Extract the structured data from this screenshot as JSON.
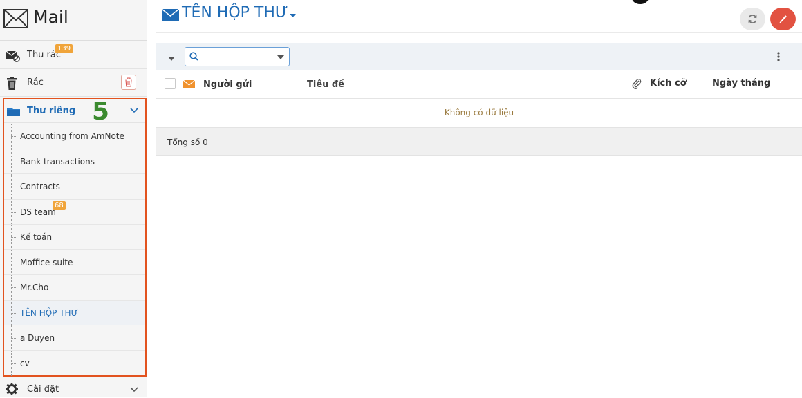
{
  "app": {
    "title": "Mail",
    "icon": "mail-envelope-icon"
  },
  "sidebar": {
    "spam": {
      "label": "Thư rác",
      "badge": "139",
      "icon": "spam-mail-icon"
    },
    "trash": {
      "label": "Rác",
      "icon": "trash-icon"
    },
    "folder": {
      "label": "Thư riêng",
      "step_number": "5",
      "icon": "folder-icon",
      "items": [
        {
          "label": "Accounting from AmNote"
        },
        {
          "label": "Bank transactions"
        },
        {
          "label": "Contracts"
        },
        {
          "label": "DS team",
          "badge": "68"
        },
        {
          "label": "Kế toán"
        },
        {
          "label": "Moffice suite"
        },
        {
          "label": "Mr.Cho"
        },
        {
          "label": "TÊN HỘP THƯ",
          "active": true
        },
        {
          "label": "a Duyen"
        },
        {
          "label": "cv"
        }
      ]
    },
    "settings": {
      "label": "Cài đặt",
      "icon": "gear-icon"
    }
  },
  "main": {
    "mailbox_title": "TÊN HỘP THƯ",
    "search": {
      "value": "",
      "placeholder": ""
    },
    "columns": {
      "sender": "Người gửi",
      "subject": "Tiêu đề",
      "size": "Kích cỡ",
      "date": "Ngày tháng"
    },
    "empty_text": "Không có dữ liệu",
    "total_text": "Tổng số 0"
  },
  "colors": {
    "accent": "#1f6bb5",
    "highlight_border": "#e2531f",
    "step_number": "#3b8a2f",
    "badge": "#f0a43a",
    "compose": "#e25241"
  }
}
